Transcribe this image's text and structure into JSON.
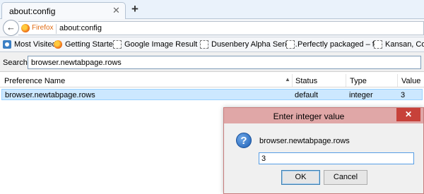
{
  "tabs": [
    {
      "title": "about:config",
      "close": "✕"
    }
  ],
  "new_tab": "+",
  "nav": {
    "back": "←",
    "identity_label": "Firefox",
    "url": "about:config"
  },
  "bookmarks": [
    {
      "label": "Most Visited",
      "icon": "most-visited-icon"
    },
    {
      "label": "Getting Started",
      "icon": "firefox-icon"
    },
    {
      "label": "Google Image Result f...",
      "icon": "page-icon"
    },
    {
      "label": "Dusenbery Alpha Serie...",
      "icon": "page-icon"
    },
    {
      "label": "Perfectly packaged – fr...",
      "icon": "page-icon"
    },
    {
      "label": "Kansan, Conte",
      "icon": "page-icon"
    }
  ],
  "search": {
    "label": "Search:",
    "value": "browser.newtabpage.rows"
  },
  "table": {
    "columns": [
      "Preference Name",
      "Status",
      "Type",
      "Value"
    ],
    "sort_arrow": "▲",
    "rows": [
      {
        "name": "browser.newtabpage.rows",
        "status": "default",
        "type": "integer",
        "value": "3"
      }
    ]
  },
  "dialog": {
    "title": "Enter integer value",
    "close": "✕",
    "icon": "question-icon",
    "icon_glyph": "?",
    "preference": "browser.newtabpage.rows",
    "input_value": "3",
    "ok_label": "OK",
    "cancel_label": "Cancel"
  },
  "colors": {
    "selected_row": "#cce8ff",
    "dialog_titlebar": "#e0a7a7",
    "dialog_close": "#c7413a",
    "firefox_orange": "#e06a12"
  }
}
